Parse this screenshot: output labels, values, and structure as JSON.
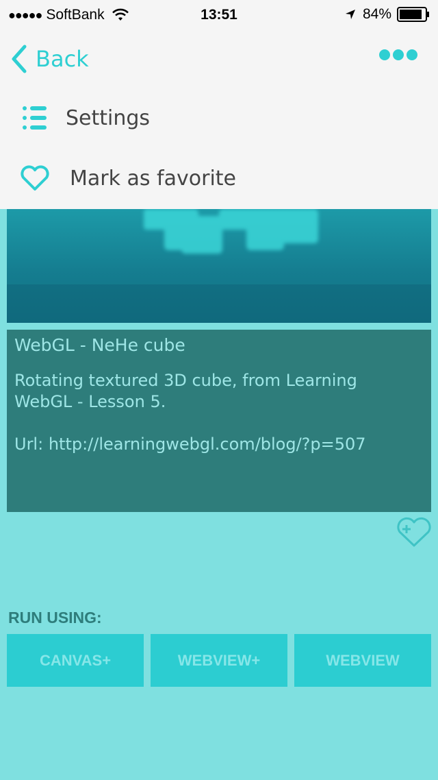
{
  "status_bar": {
    "carrier": "SoftBank",
    "time": "13:51",
    "battery": "84%"
  },
  "nav": {
    "back_label": "Back"
  },
  "menu": {
    "settings_label": "Settings",
    "favorite_label": "Mark as favorite"
  },
  "card": {
    "title": "WebGL - NeHe cube",
    "description": "Rotating textured 3D cube, from Learning\nWebGL - Lesson 5.\n\nUrl: http://learningwebgl.com/blog/?p=507"
  },
  "run": {
    "label": "RUN USING:",
    "buttons": [
      "CANVAS+",
      "WEBVIEW+",
      "WEBVIEW"
    ]
  },
  "colors": {
    "accent": "#2ecfd2",
    "background": "#7fe0e0",
    "card": "#2e7d7b"
  }
}
